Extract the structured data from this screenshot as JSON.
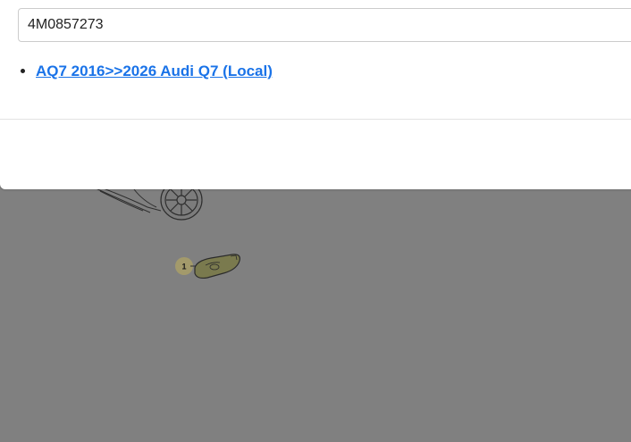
{
  "search": {
    "value": "4M0857273"
  },
  "results": [
    {
      "label": "AQ7 2016>>2026 Audi Q7 (Local)"
    }
  ],
  "diagram": {
    "callout_number": "1"
  }
}
